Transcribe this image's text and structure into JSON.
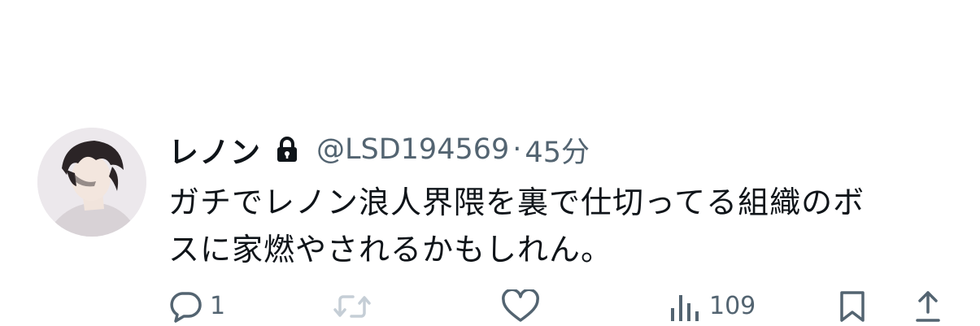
{
  "tweet": {
    "display_name": "レノン",
    "handle": "@LSD194569",
    "separator": "·",
    "time": "45分",
    "text_line_1": "ガチでレノン浪人界隈を裏で仕切ってる組織のボ",
    "text_line_2": "スに家燃やされるかもしれん。",
    "protected_icon": "lock-icon"
  },
  "actions": {
    "reply_count": "1",
    "repost_count": "",
    "like_count": "",
    "views_count": "109",
    "icons": [
      "reply-icon",
      "repost-icon",
      "like-icon",
      "views-icon",
      "bookmark-icon",
      "share-icon"
    ]
  },
  "colors": {
    "text_primary": "#0f1419",
    "text_secondary": "#536471",
    "repost_disabled": "#c5ced6"
  }
}
